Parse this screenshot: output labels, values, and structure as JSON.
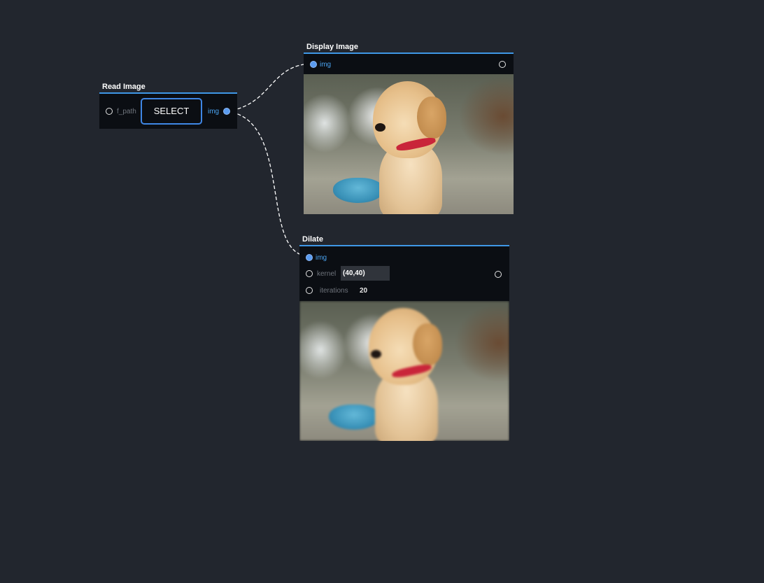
{
  "nodes": {
    "read_image": {
      "title": "Read Image",
      "inputs": {
        "f_path": "f_path"
      },
      "select_label": "SELECT",
      "outputs": {
        "img": "img"
      }
    },
    "display_image": {
      "title": "Display Image",
      "inputs": {
        "img": "img"
      }
    },
    "dilate": {
      "title": "Dilate",
      "inputs": {
        "img": "img",
        "kernel_label": "kernel",
        "kernel_value": "(40,40)",
        "iterations_label": "iterations",
        "iterations_value": "20"
      }
    }
  },
  "colors": {
    "background": "#22262e",
    "node_body": "#0b0e13",
    "accent": "#3f97e6",
    "active_label": "#4aa3f0",
    "wire": "#ffffff"
  },
  "icons": {
    "port_empty": "port-circle-icon",
    "port_connected": "port-connected-icon"
  }
}
